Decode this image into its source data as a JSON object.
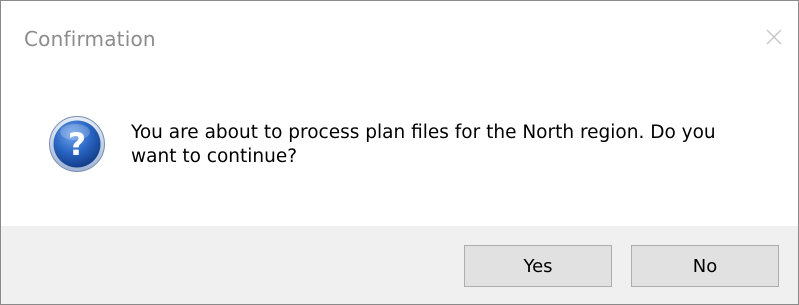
{
  "window": {
    "title": "Confirmation"
  },
  "message": {
    "icon": "question-icon",
    "text": "You are about to process plan files for the North region. Do you want to continue?"
  },
  "buttons": {
    "yes_label": "Yes",
    "no_label": "No"
  },
  "colors": {
    "button_bar": "#f0f0f0",
    "button_face": "#e1e1e1",
    "icon_blue": "#1f5bb5"
  }
}
